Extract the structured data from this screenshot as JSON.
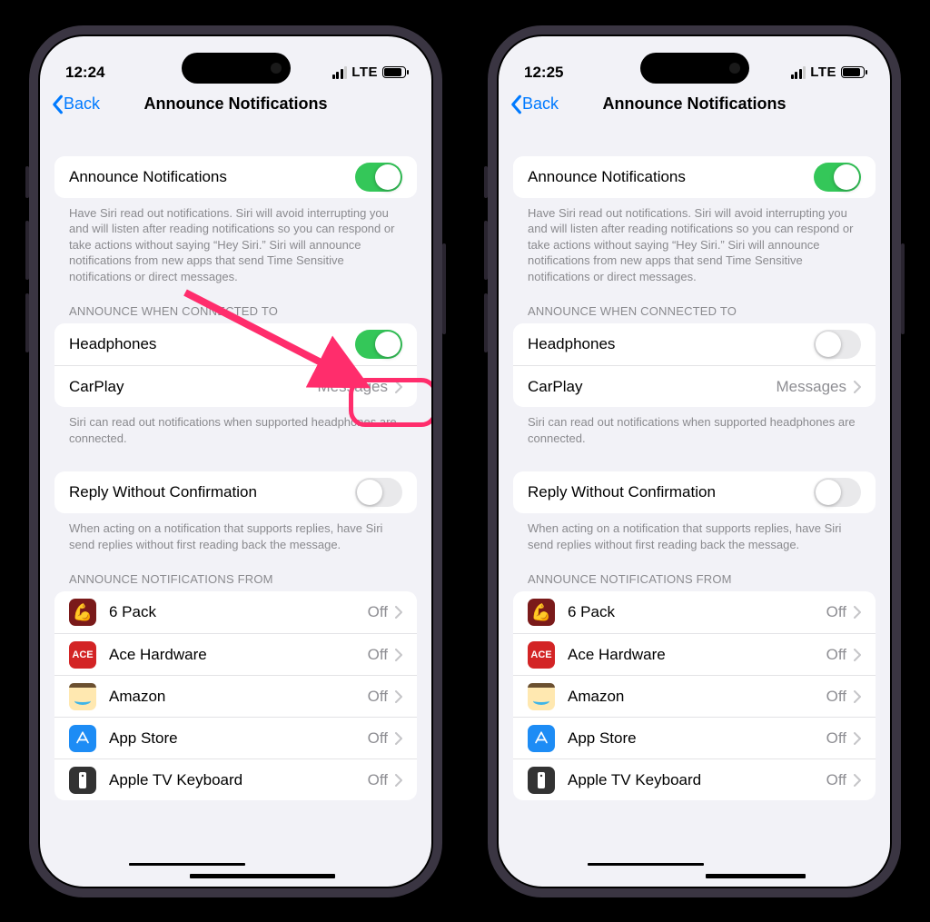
{
  "phones": [
    {
      "time": "12:24",
      "network": "LTE",
      "nav": {
        "back": "Back",
        "title": "Announce Notifications"
      },
      "headphones_on": true,
      "highlight": true
    },
    {
      "time": "12:25",
      "network": "LTE",
      "nav": {
        "back": "Back",
        "title": "Announce Notifications"
      },
      "headphones_on": false,
      "highlight": false
    }
  ],
  "shared": {
    "master_toggle_label": "Announce Notifications",
    "master_footer": "Have Siri read out notifications. Siri will avoid interrupting you and will listen after reading notifications so you can respond or take actions without saying “Hey Siri.” Siri will announce notifications from new apps that send Time Sensitive notifications or direct messages.",
    "section_connected_header": "ANNOUNCE WHEN CONNECTED TO",
    "headphones_label": "Headphones",
    "carplay_label": "CarPlay",
    "carplay_value": "Messages",
    "connected_footer": "Siri can read out notifications when supported headphones are connected.",
    "reply_label": "Reply Without Confirmation",
    "reply_footer": "When acting on a notification that supports replies, have Siri send replies without first reading back the message.",
    "apps_header": "ANNOUNCE NOTIFICATIONS FROM",
    "apps": [
      {
        "name": "6 Pack",
        "status": "Off",
        "icon": "sixpack"
      },
      {
        "name": "Ace Hardware",
        "status": "Off",
        "icon": "ace"
      },
      {
        "name": "Amazon",
        "status": "Off",
        "icon": "amazon"
      },
      {
        "name": "App Store",
        "status": "Off",
        "icon": "appstore"
      },
      {
        "name": "Apple TV Keyboard",
        "status": "Off",
        "icon": "appletv"
      }
    ]
  }
}
